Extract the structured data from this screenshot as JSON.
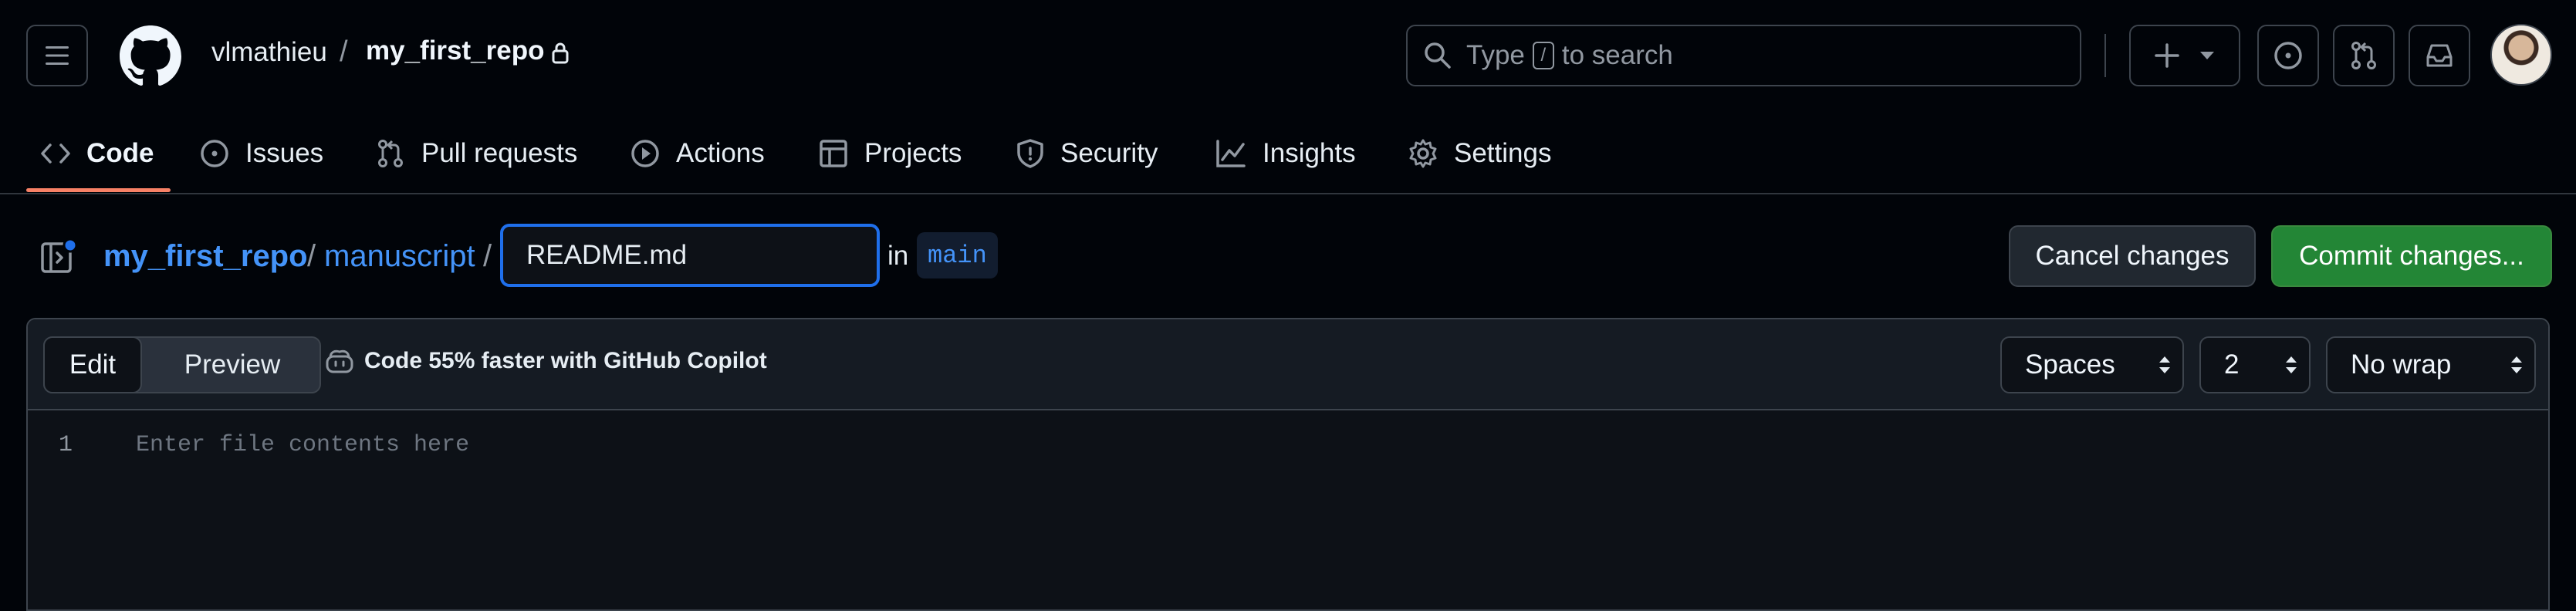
{
  "header": {
    "owner": "vlmathieu",
    "separator": "/",
    "repo": "my_first_repo",
    "search_prefix": "Type",
    "search_key": "/",
    "search_suffix": "to search"
  },
  "nav": {
    "items": [
      {
        "label": "Code",
        "icon": "code-icon",
        "active": true
      },
      {
        "label": "Issues",
        "icon": "issue-opened-icon"
      },
      {
        "label": "Pull requests",
        "icon": "git-pull-request-icon"
      },
      {
        "label": "Actions",
        "icon": "play-icon"
      },
      {
        "label": "Projects",
        "icon": "table-icon"
      },
      {
        "label": "Security",
        "icon": "shield-icon"
      },
      {
        "label": "Insights",
        "icon": "graph-icon"
      },
      {
        "label": "Settings",
        "icon": "gear-icon"
      }
    ]
  },
  "breadcrumb": {
    "repo": "my_first_repo",
    "folder": "manuscript",
    "sep": "/",
    "filename": "README.md",
    "in_label": "in",
    "branch": "main"
  },
  "actions": {
    "cancel": "Cancel changes",
    "commit": "Commit changes..."
  },
  "editor": {
    "tabs": [
      "Edit",
      "Preview"
    ],
    "copilot_text": "Code 55% faster with GitHub Copilot",
    "indent_mode": "Spaces",
    "indent_size": "2",
    "wrap_mode": "No wrap",
    "line_number": "1",
    "placeholder": "Enter file contents here"
  },
  "colors": {
    "background": "#010409",
    "link": "#4493f8",
    "commit_button": "#238636",
    "active_tab_underline": "#f78166",
    "focus_border": "#1f6feb"
  }
}
